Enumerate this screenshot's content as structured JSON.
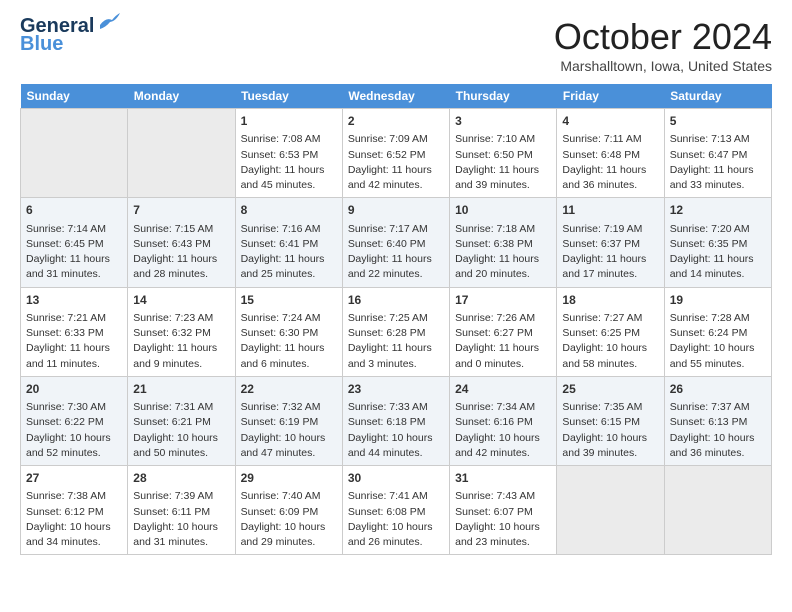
{
  "header": {
    "logo_line1": "General",
    "logo_line2": "Blue",
    "month": "October 2024",
    "location": "Marshalltown, Iowa, United States"
  },
  "weekdays": [
    "Sunday",
    "Monday",
    "Tuesday",
    "Wednesday",
    "Thursday",
    "Friday",
    "Saturday"
  ],
  "weeks": [
    [
      {
        "day": "",
        "empty": true
      },
      {
        "day": "",
        "empty": true
      },
      {
        "day": "1",
        "sunrise": "7:08 AM",
        "sunset": "6:53 PM",
        "daylight": "11 hours and 45 minutes."
      },
      {
        "day": "2",
        "sunrise": "7:09 AM",
        "sunset": "6:52 PM",
        "daylight": "11 hours and 42 minutes."
      },
      {
        "day": "3",
        "sunrise": "7:10 AM",
        "sunset": "6:50 PM",
        "daylight": "11 hours and 39 minutes."
      },
      {
        "day": "4",
        "sunrise": "7:11 AM",
        "sunset": "6:48 PM",
        "daylight": "11 hours and 36 minutes."
      },
      {
        "day": "5",
        "sunrise": "7:13 AM",
        "sunset": "6:47 PM",
        "daylight": "11 hours and 33 minutes."
      }
    ],
    [
      {
        "day": "6",
        "sunrise": "7:14 AM",
        "sunset": "6:45 PM",
        "daylight": "11 hours and 31 minutes."
      },
      {
        "day": "7",
        "sunrise": "7:15 AM",
        "sunset": "6:43 PM",
        "daylight": "11 hours and 28 minutes."
      },
      {
        "day": "8",
        "sunrise": "7:16 AM",
        "sunset": "6:41 PM",
        "daylight": "11 hours and 25 minutes."
      },
      {
        "day": "9",
        "sunrise": "7:17 AM",
        "sunset": "6:40 PM",
        "daylight": "11 hours and 22 minutes."
      },
      {
        "day": "10",
        "sunrise": "7:18 AM",
        "sunset": "6:38 PM",
        "daylight": "11 hours and 20 minutes."
      },
      {
        "day": "11",
        "sunrise": "7:19 AM",
        "sunset": "6:37 PM",
        "daylight": "11 hours and 17 minutes."
      },
      {
        "day": "12",
        "sunrise": "7:20 AM",
        "sunset": "6:35 PM",
        "daylight": "11 hours and 14 minutes."
      }
    ],
    [
      {
        "day": "13",
        "sunrise": "7:21 AM",
        "sunset": "6:33 PM",
        "daylight": "11 hours and 11 minutes."
      },
      {
        "day": "14",
        "sunrise": "7:23 AM",
        "sunset": "6:32 PM",
        "daylight": "11 hours and 9 minutes."
      },
      {
        "day": "15",
        "sunrise": "7:24 AM",
        "sunset": "6:30 PM",
        "daylight": "11 hours and 6 minutes."
      },
      {
        "day": "16",
        "sunrise": "7:25 AM",
        "sunset": "6:28 PM",
        "daylight": "11 hours and 3 minutes."
      },
      {
        "day": "17",
        "sunrise": "7:26 AM",
        "sunset": "6:27 PM",
        "daylight": "11 hours and 0 minutes."
      },
      {
        "day": "18",
        "sunrise": "7:27 AM",
        "sunset": "6:25 PM",
        "daylight": "10 hours and 58 minutes."
      },
      {
        "day": "19",
        "sunrise": "7:28 AM",
        "sunset": "6:24 PM",
        "daylight": "10 hours and 55 minutes."
      }
    ],
    [
      {
        "day": "20",
        "sunrise": "7:30 AM",
        "sunset": "6:22 PM",
        "daylight": "10 hours and 52 minutes."
      },
      {
        "day": "21",
        "sunrise": "7:31 AM",
        "sunset": "6:21 PM",
        "daylight": "10 hours and 50 minutes."
      },
      {
        "day": "22",
        "sunrise": "7:32 AM",
        "sunset": "6:19 PM",
        "daylight": "10 hours and 47 minutes."
      },
      {
        "day": "23",
        "sunrise": "7:33 AM",
        "sunset": "6:18 PM",
        "daylight": "10 hours and 44 minutes."
      },
      {
        "day": "24",
        "sunrise": "7:34 AM",
        "sunset": "6:16 PM",
        "daylight": "10 hours and 42 minutes."
      },
      {
        "day": "25",
        "sunrise": "7:35 AM",
        "sunset": "6:15 PM",
        "daylight": "10 hours and 39 minutes."
      },
      {
        "day": "26",
        "sunrise": "7:37 AM",
        "sunset": "6:13 PM",
        "daylight": "10 hours and 36 minutes."
      }
    ],
    [
      {
        "day": "27",
        "sunrise": "7:38 AM",
        "sunset": "6:12 PM",
        "daylight": "10 hours and 34 minutes."
      },
      {
        "day": "28",
        "sunrise": "7:39 AM",
        "sunset": "6:11 PM",
        "daylight": "10 hours and 31 minutes."
      },
      {
        "day": "29",
        "sunrise": "7:40 AM",
        "sunset": "6:09 PM",
        "daylight": "10 hours and 29 minutes."
      },
      {
        "day": "30",
        "sunrise": "7:41 AM",
        "sunset": "6:08 PM",
        "daylight": "10 hours and 26 minutes."
      },
      {
        "day": "31",
        "sunrise": "7:43 AM",
        "sunset": "6:07 PM",
        "daylight": "10 hours and 23 minutes."
      },
      {
        "day": "",
        "empty": true
      },
      {
        "day": "",
        "empty": true
      }
    ]
  ]
}
